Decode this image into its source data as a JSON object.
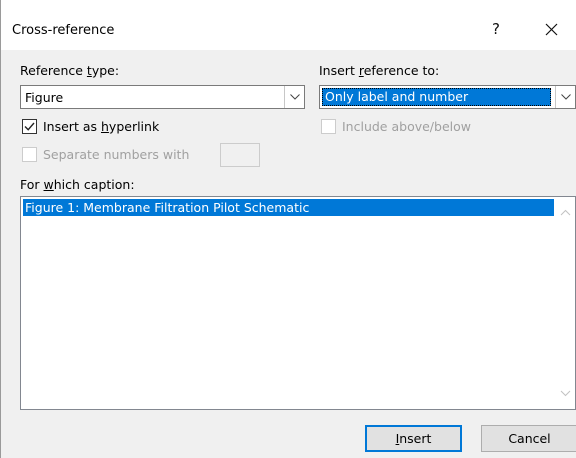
{
  "dialog": {
    "title": "Cross-reference",
    "help_label": "?",
    "close_label": "×"
  },
  "reference_type": {
    "label_pre": "Reference ",
    "label_u": "t",
    "label_post": "ype:",
    "value": "Figure"
  },
  "insert_reference_to": {
    "label_pre": "Insert ",
    "label_u": "r",
    "label_post": "eference to:",
    "value": "Only label and number"
  },
  "insert_as_hyperlink": {
    "label_pre": "Insert as ",
    "label_u": "h",
    "label_post": "yperlink",
    "checked": true
  },
  "include_above_below": {
    "label": "Include above/below",
    "checked": false,
    "enabled": false
  },
  "separate_numbers": {
    "label": "Separate numbers with",
    "checked": false,
    "enabled": false,
    "value": ""
  },
  "caption_list": {
    "label_pre": "For ",
    "label_u": "w",
    "label_post": "hich caption:",
    "items": [
      {
        "text": "Figure 1: Membrane Filtration Pilot Schematic",
        "selected": true
      }
    ]
  },
  "buttons": {
    "insert_u": "I",
    "insert_rest": "nsert",
    "cancel": "Cancel"
  },
  "colors": {
    "accent": "#0078d7",
    "dialog_bg": "#f0f0f0"
  }
}
